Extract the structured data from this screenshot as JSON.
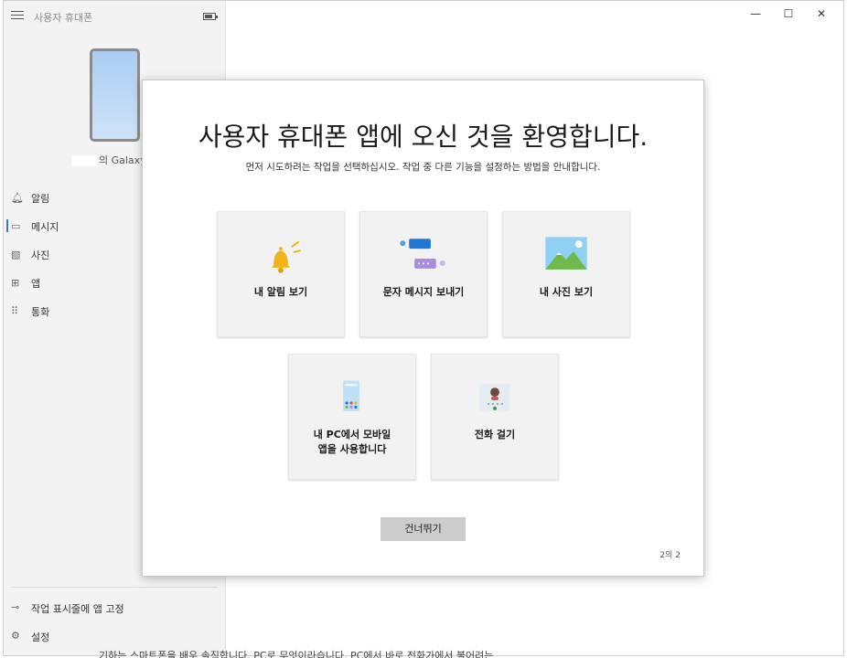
{
  "window": {
    "app_title": "사용자 휴대폰",
    "controls": {
      "minimize": "—",
      "maximize": "☐",
      "close": "✕"
    }
  },
  "device": {
    "name": "의 Galaxy S"
  },
  "sidebar": {
    "items": [
      {
        "label": "알림",
        "icon": "bell-icon",
        "glyph": "🔔︎"
      },
      {
        "label": "메시지",
        "icon": "message-icon",
        "glyph": "▭"
      },
      {
        "label": "사진",
        "icon": "photo-icon",
        "glyph": "▧"
      },
      {
        "label": "앱",
        "icon": "apps-icon",
        "glyph": "⊞"
      },
      {
        "label": "통화",
        "icon": "dialpad-icon",
        "glyph": "⠿"
      }
    ],
    "pin_label": "작업 표시줄에 앱 고정",
    "settings_label": "설정"
  },
  "background_text": "기하는 스마트폰을 배우 솔직합니다. PC로 무엇이라습니다. PC에서 바로 전화가에서 불어려는",
  "dialog": {
    "title": "사용자 휴대폰 앱에 오신 것을 환영합니다.",
    "subtitle": "먼저 시도하려는 작업을 선택하십시오. 작업 중 다른 기능을 설정하는 방법을 안내합니다.",
    "cards": [
      {
        "label": "내 알림 보기",
        "icon": "notification-bell-icon"
      },
      {
        "label": "문자 메시지 보내기",
        "icon": "chat-messages-icon"
      },
      {
        "label": "내 사진 보기",
        "icon": "landscape-photo-icon"
      },
      {
        "label": "내 PC에서 모바일 앱을 사용합니다",
        "icon": "phone-apps-icon"
      },
      {
        "label": "전화 걸기",
        "icon": "phone-call-icon"
      }
    ],
    "skip_label": "건너뛰기",
    "pager": "2의 2"
  },
  "colors": {
    "accent": "#3a78d8",
    "button_bg": "#cccccc",
    "card_bg": "#f2f2f2"
  }
}
